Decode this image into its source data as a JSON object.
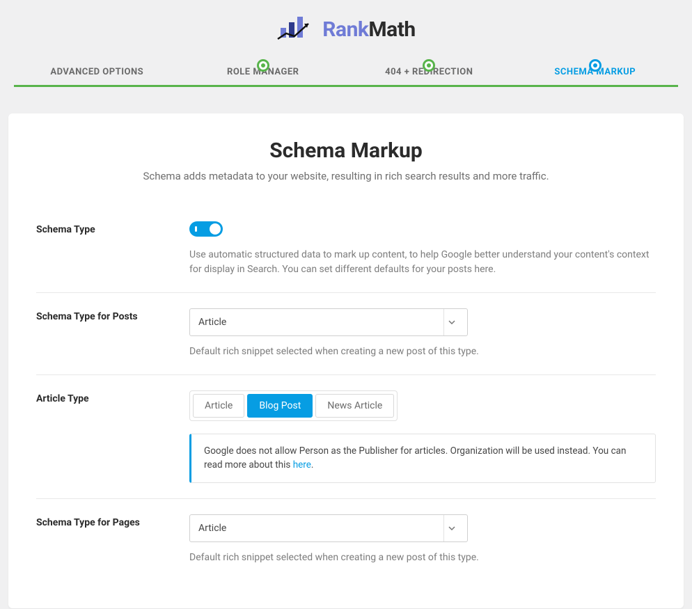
{
  "brand": {
    "rank": "Rank",
    "math": "Math"
  },
  "steps": {
    "advanced": "ADVANCED OPTIONS",
    "role": "ROLE MANAGER",
    "redir": "404 + REDIRECTION",
    "schema": "SCHEMA MARKUP"
  },
  "page": {
    "title": "Schema Markup",
    "subtitle": "Schema adds metadata to your website, resulting in rich search results and more traffic."
  },
  "fields": {
    "schema_type": {
      "label": "Schema Type",
      "help": "Use automatic structured data to mark up content, to help Google better understand your content's context for display in Search. You can set different defaults for your posts here."
    },
    "posts": {
      "label": "Schema Type for Posts",
      "value": "Article",
      "help": "Default rich snippet selected when creating a new post of this type."
    },
    "article_type": {
      "label": "Article Type",
      "options": {
        "article": "Article",
        "blog": "Blog Post",
        "news": "News Article"
      },
      "notice_pre": "Google does not allow Person as the Publisher for articles. Organization will be used instead. You can read more about this ",
      "notice_link": "here",
      "notice_post": "."
    },
    "pages": {
      "label": "Schema Type for Pages",
      "value": "Article",
      "help": "Default rich snippet selected when creating a new post of this type."
    }
  }
}
